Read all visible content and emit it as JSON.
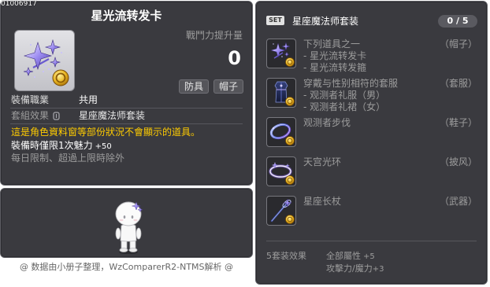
{
  "item_id": "01006917",
  "item": {
    "name": "星光流转发卡",
    "icon": "hairpin-icon",
    "combat_power_label": "戰鬥力提升量",
    "combat_power_value": "0",
    "tags": [
      "防具",
      "帽子"
    ],
    "job_label": "裝備職業",
    "job_value": "共用",
    "set_label": "套組效果",
    "set_value": "星座魔法师套装",
    "notice": "這是角色資料窗等部份狀況不會顯示的道具。",
    "charm_text": "裝備時僅限1次魅力",
    "charm_value": "+50",
    "limit_note": "每日限制、超過上限時除外"
  },
  "preview": {
    "icon": "character-preview"
  },
  "footer": "@ 数据由小册子整理，WzComparerR2-NTMS解析 @",
  "set": {
    "badge": "SET",
    "name": "星座魔法师套装",
    "progress": "0 / 5",
    "items": [
      {
        "icon": "hairpin-icon",
        "lines": [
          "下列道具之一",
          "- 星光流转发卡",
          "- 星光流转发箍"
        ],
        "slot": "（帽子）"
      },
      {
        "icon": "outfit-icon",
        "lines": [
          "穿戴与性别相符的套服",
          "- 观测者礼服（男）",
          "- 观测者礼裙（女）"
        ],
        "slot": "（套服）"
      },
      {
        "icon": "shoes-icon",
        "lines": [
          "观测者步伐"
        ],
        "slot": "（鞋子）"
      },
      {
        "icon": "halo-icon",
        "lines": [
          "天宫光环"
        ],
        "slot": "（披风）"
      },
      {
        "icon": "staff-icon",
        "lines": [
          "星座长杖"
        ],
        "slot": "（武器）"
      }
    ],
    "effect_label": "5套装效果",
    "effects": [
      {
        "name": "全部屬性",
        "value": "+5"
      },
      {
        "name": "攻擊力/魔力",
        "value": "+3"
      }
    ]
  },
  "colors": {
    "panel": "#3a3a3f",
    "border": "#5e5e64",
    "text": "#ffffff",
    "muted": "#9c9c9c",
    "notice": "#ffcc00",
    "coin": "#e8b420"
  }
}
